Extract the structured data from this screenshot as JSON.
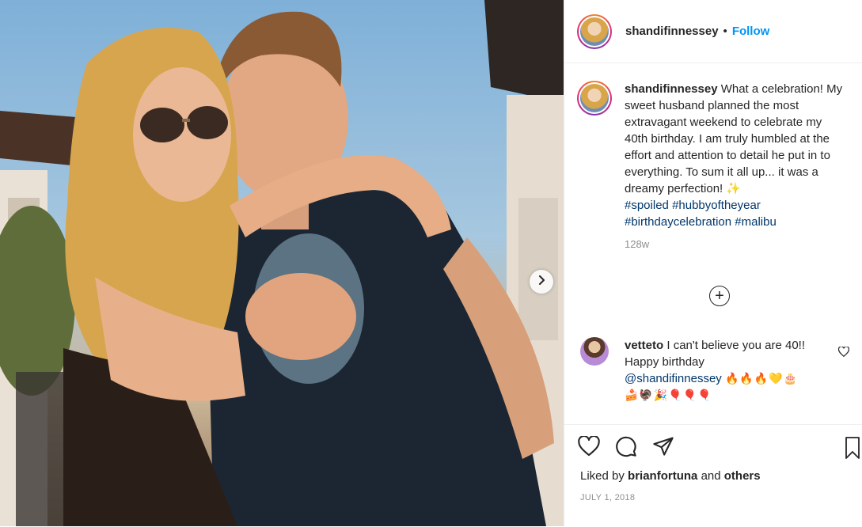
{
  "post": {
    "username": "shandifinnessey",
    "follow_label": "Follow",
    "header_dot": "•",
    "caption": {
      "username": "shandifinnessey",
      "text": "What a celebration! My sweet husband planned the most extravagant weekend to celebrate my 40th birthday. I am truly humbled at the effort and attention to detail he put in to everything. To sum it all up... it was a dreamy perfection!",
      "emoji": "✨",
      "hashtags": [
        "#spoiled",
        "#hubbyoftheyear",
        "#birthdaycelebration",
        "#malibu"
      ]
    },
    "caption_age": "128w",
    "load_more_symbol": "+",
    "comment": {
      "username": "vetteto",
      "text": "I can't believe you are 40!! Happy birthday",
      "mention": "@shandifinnessey",
      "emojis_line1": "🔥🔥🔥💛🎂",
      "emojis_line2": "🍰🦃🎉🎈🎈🎈"
    },
    "likes": {
      "prefix": "Liked by",
      "user": "brianfortuna",
      "joiner": "and",
      "others": "others"
    },
    "date": "JULY 1, 2018"
  },
  "icons": {
    "next": "chevron-right-icon",
    "like": "heart-icon",
    "comment": "comment-icon",
    "share": "paper-plane-icon",
    "save": "bookmark-icon",
    "comment_like": "heart-small-icon",
    "load_more": "plus-circle-icon"
  },
  "colors": {
    "link_blue": "#0095f6",
    "hashtag": "#00376b",
    "muted": "#8e8e8e",
    "text": "#262626"
  }
}
